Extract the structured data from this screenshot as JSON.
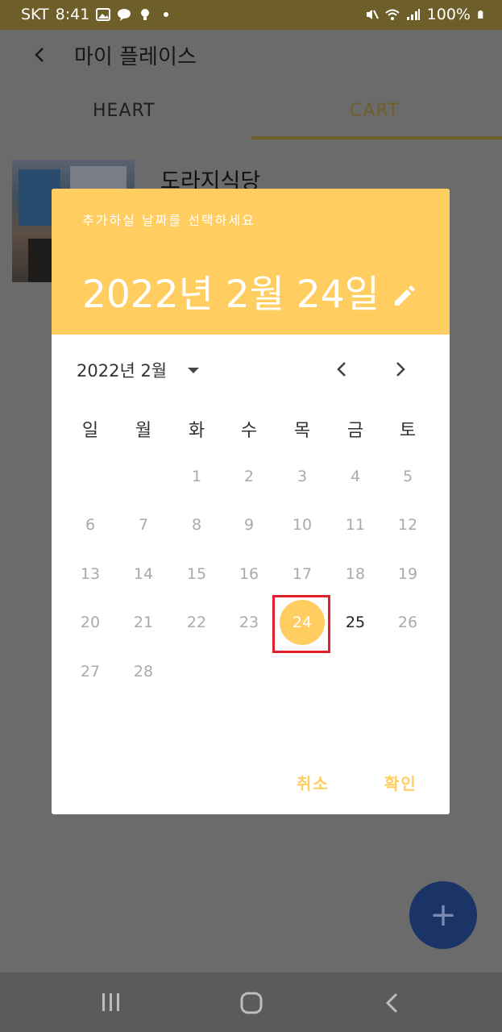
{
  "status_bar": {
    "carrier": "SKT",
    "time": "8:41",
    "battery": "100%",
    "icons": [
      "image-icon",
      "kakaotalk-icon",
      "bulb-icon",
      "dot-icon",
      "mute-icon",
      "wifi-icon",
      "signal-icon",
      "battery-icon"
    ]
  },
  "app_bar": {
    "title": "마이 플레이스"
  },
  "tabs": [
    {
      "label": "HEART"
    },
    {
      "label": "CART"
    }
  ],
  "list": {
    "items": [
      {
        "name": "도라지식당"
      }
    ]
  },
  "dialog": {
    "subtitle": "추가하실 날짜를 선택하세요",
    "selected_date": "2022년 2월 24일",
    "month_label": "2022년 2월",
    "weekdays": [
      "일",
      "월",
      "화",
      "수",
      "목",
      "금",
      "토"
    ],
    "days": [
      "1",
      "2",
      "3",
      "4",
      "5",
      "6",
      "7",
      "8",
      "9",
      "10",
      "11",
      "12",
      "13",
      "14",
      "15",
      "16",
      "17",
      "18",
      "19",
      "20",
      "21",
      "22",
      "23",
      "24",
      "25",
      "26",
      "27",
      "28"
    ],
    "selected_day": "24",
    "cancel_label": "취소",
    "ok_label": "확인"
  },
  "fab": {
    "label": "+"
  },
  "colors": {
    "accent": "#ffcd60",
    "status_bar": "#6e5f2a",
    "fab": "#1b3468",
    "highlight": "#e0202a"
  }
}
